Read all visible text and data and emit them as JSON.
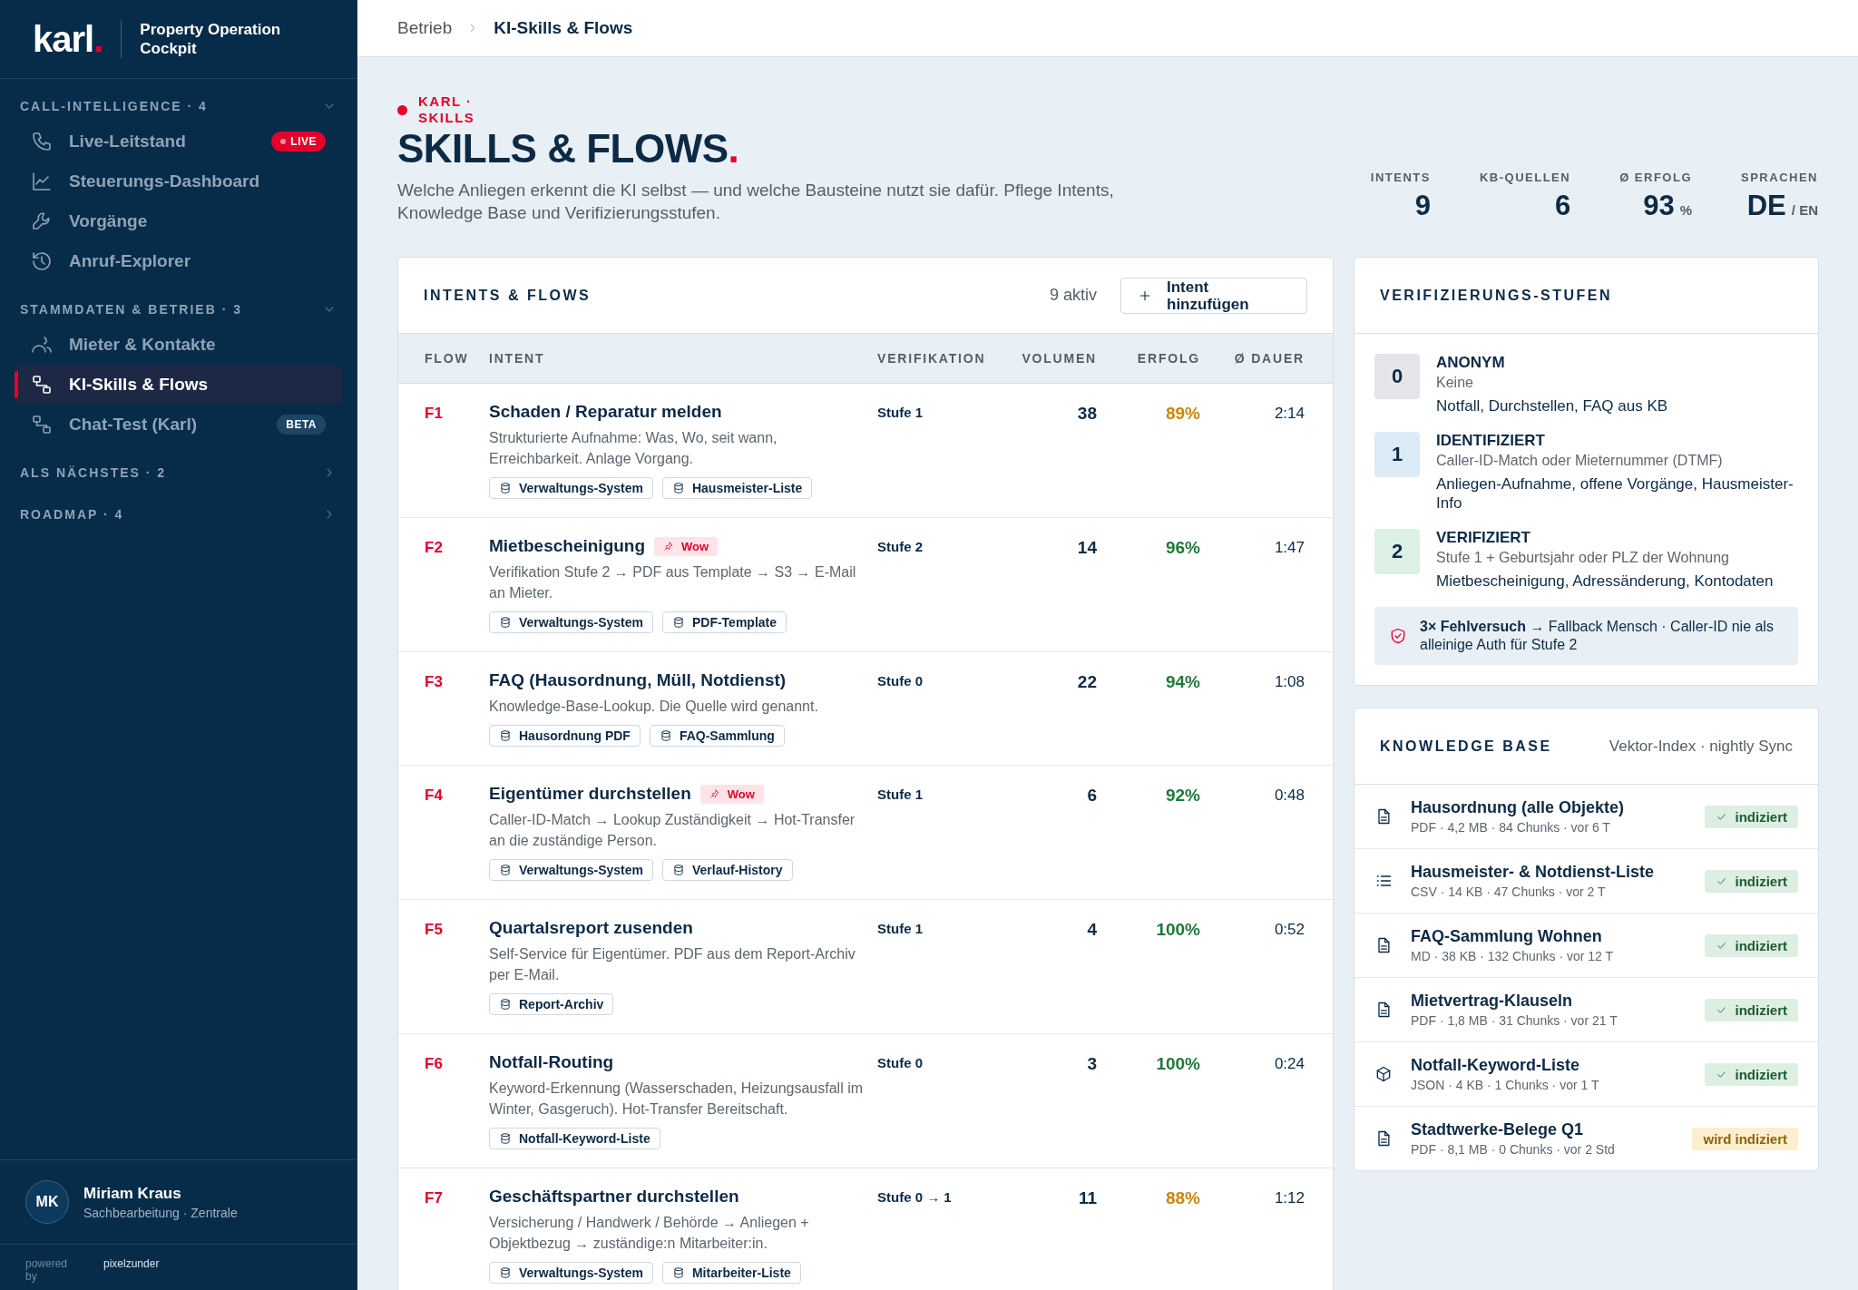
{
  "sidebar": {
    "logo": "karl",
    "logo_dot": ".",
    "product": "Property Operation Cockpit",
    "sections": [
      {
        "title": "CALL-INTELLIGENCE",
        "count": "· 4",
        "expanded": true,
        "items": [
          {
            "label": "Live-Leitstand",
            "selected": false,
            "badge": {
              "text": "LIVE",
              "kind": "live"
            }
          },
          {
            "label": "Steuerungs-Dashboard",
            "selected": false
          },
          {
            "label": "Vorgänge",
            "selected": false
          },
          {
            "label": "Anruf-Explorer",
            "selected": false
          }
        ]
      },
      {
        "title": "STAMMDATEN & BETRIEB",
        "count": "· 3",
        "expanded": true,
        "items": [
          {
            "label": "Mieter & Kontakte",
            "selected": false
          },
          {
            "label": "KI-Skills & Flows",
            "selected": true
          },
          {
            "label": "Chat-Test (Karl)",
            "selected": false,
            "badge": {
              "text": "BETA",
              "kind": "beta"
            }
          }
        ]
      },
      {
        "title": "ALS NÄCHSTES",
        "count": "· 2",
        "expanded": false
      },
      {
        "title": "ROADMAP",
        "count": "· 4",
        "expanded": false
      }
    ],
    "user": {
      "initials": "MK",
      "name": "Miriam Kraus",
      "role": "Sachbearbeitung · Zentrale"
    },
    "powered": {
      "label": "powered by",
      "brand": "pixelzunder"
    }
  },
  "breadcrumb": [
    "Betrieb",
    "KI-Skills & Flows"
  ],
  "header": {
    "eyebrow": "KARL · SKILLS",
    "title": "SKILLS & FLOWS",
    "title_dot": ".",
    "description": "Welche Anliegen erkennt die KI selbst — und welche Bausteine nutzt sie dafür. Pflege Intents, Knowledge Base und Verifizierungsstufen.",
    "stats": [
      {
        "label": "INTENTS",
        "value": "9"
      },
      {
        "label": "KB-QUELLEN",
        "value": "6"
      },
      {
        "label": "Ø ERFOLG",
        "value": "93",
        "unit": "%"
      },
      {
        "label": "SPRACHEN",
        "value": "DE",
        "unit": "/ EN"
      }
    ]
  },
  "intents": {
    "title": "INTENTS & FLOWS",
    "count": "9 aktiv",
    "add_button": "Intent hinzufügen",
    "columns": [
      "FLOW",
      "INTENT",
      "VERIFIKATION",
      "VOLUMEN",
      "ERFOLG",
      "Ø DAUER"
    ],
    "rows": [
      {
        "flow": "F1",
        "title": "Schaden / Reparatur melden",
        "description": "Strukturierte Aufnahme: Was, Wo, seit wann, Erreichbarkeit. Anlage Vorgang.",
        "sources": [
          "Verwaltungs-System",
          "Hausmeister-Liste"
        ],
        "verification": "Stufe 1",
        "volume": "38",
        "success": "89%",
        "color": "#c8860a",
        "duration": "2:14"
      },
      {
        "flow": "F2",
        "title": "Mietbescheinigung",
        "tag": "Wow",
        "description": "Verifikation Stufe 2 → PDF aus Template → S3 → E-Mail an Mieter.",
        "sources": [
          "Verwaltungs-System",
          "PDF-Template"
        ],
        "verification": "Stufe 2",
        "volume": "14",
        "success": "96%",
        "color": "#1f7a3a",
        "duration": "1:47"
      },
      {
        "flow": "F3",
        "title": "FAQ (Hausordnung, Müll, Notdienst)",
        "description": "Knowledge-Base-Lookup. Die Quelle wird genannt.",
        "sources": [
          "Hausordnung PDF",
          "FAQ-Sammlung"
        ],
        "verification": "Stufe 0",
        "volume": "22",
        "success": "94%",
        "color": "#1f7a3a",
        "duration": "1:08"
      },
      {
        "flow": "F4",
        "title": "Eigentümer durchstellen",
        "tag": "Wow",
        "description": "Caller-ID-Match → Lookup Zuständigkeit → Hot-Transfer an die zuständige Person.",
        "sources": [
          "Verwaltungs-System",
          "Verlauf-History"
        ],
        "verification": "Stufe 1",
        "volume": "6",
        "success": "92%",
        "color": "#1f7a3a",
        "duration": "0:48"
      },
      {
        "flow": "F5",
        "title": "Quartalsreport zusenden",
        "description": "Self-Service für Eigentümer. PDF aus dem Report-Archiv per E-Mail.",
        "sources": [
          "Report-Archiv"
        ],
        "verification": "Stufe 1",
        "volume": "4",
        "success": "100%",
        "color": "#1f7a3a",
        "duration": "0:52"
      },
      {
        "flow": "F6",
        "title": "Notfall-Routing",
        "description": "Keyword-Erkennung (Wasserschaden, Heizungsausfall im Winter, Gasgeruch). Hot-Transfer Bereitschaft.",
        "sources": [
          "Notfall-Keyword-Liste"
        ],
        "verification": "Stufe 0",
        "volume": "3",
        "success": "100%",
        "color": "#1f7a3a",
        "duration": "0:24"
      },
      {
        "flow": "F7",
        "title": "Geschäftspartner durchstellen",
        "description": "Versicherung / Handwerk / Behörde → Anliegen + Objektbezug → zuständige:n Mitarbeiter:in.",
        "sources": [
          "Verwaltungs-System",
          "Mitarbeiter-Liste"
        ],
        "verification": "Stufe 0 → 1",
        "volume": "11",
        "success": "88%",
        "color": "#c8860a",
        "duration": "1:12"
      }
    ]
  },
  "verification": {
    "title": "VERIFIZIERUNGS-STUFEN",
    "levels": [
      {
        "number": "0",
        "name": "ANONYM",
        "requirement": "Keine",
        "allows": "Notfall, Durchstellen, FAQ aus KB",
        "color": "#e3e5e8"
      },
      {
        "number": "1",
        "name": "IDENTIFIZIERT",
        "requirement": "Caller-ID-Match oder Mieternummer (DTMF)",
        "allows": "Anliegen-Aufnahme, offene Vorgänge, Hausmeister-Info",
        "color": "#dcebf6"
      },
      {
        "number": "2",
        "name": "VERIFIZIERT",
        "requirement": "Stufe 1 + Geburtsjahr oder PLZ der Wohnung",
        "allows": "Mietbescheinigung, Adressänderung, Kontodaten",
        "color": "#dcf0e3"
      }
    ],
    "note": "**3× Fehlversuch** → Fallback Mensch · Caller-ID nie als alleinige Auth für Stufe 2"
  },
  "knowledge_base": {
    "title": "KNOWLEDGE BASE",
    "subtitle": "Vektor-Index · nightly Sync",
    "items": [
      {
        "name": "Hausordnung (alle Objekte)",
        "meta": "PDF · 4,2 MB · 84 Chunks · vor 6 T",
        "status": "indiziert",
        "kind": "indexed"
      },
      {
        "name": "Hausmeister- & Notdienst-Liste",
        "meta": "CSV · 14 KB · 47 Chunks · vor 2 T",
        "status": "indiziert",
        "kind": "indexed"
      },
      {
        "name": "FAQ-Sammlung Wohnen",
        "meta": "MD · 38 KB · 132 Chunks · vor 12 T",
        "status": "indiziert",
        "kind": "indexed"
      },
      {
        "name": "Mietvertrag-Klauseln",
        "meta": "PDF · 1,8 MB · 31 Chunks · vor 21 T",
        "status": "indiziert",
        "kind": "indexed"
      },
      {
        "name": "Notfall-Keyword-Liste",
        "meta": "JSON · 4 KB · 1 Chunks · vor 1 T",
        "status": "indiziert",
        "kind": "indexed"
      },
      {
        "name": "Stadtwerke-Belege Q1",
        "meta": "PDF · 8,1 MB · 0 Chunks · vor 2 Std",
        "status": "wird indiziert",
        "kind": "pending"
      }
    ]
  }
}
